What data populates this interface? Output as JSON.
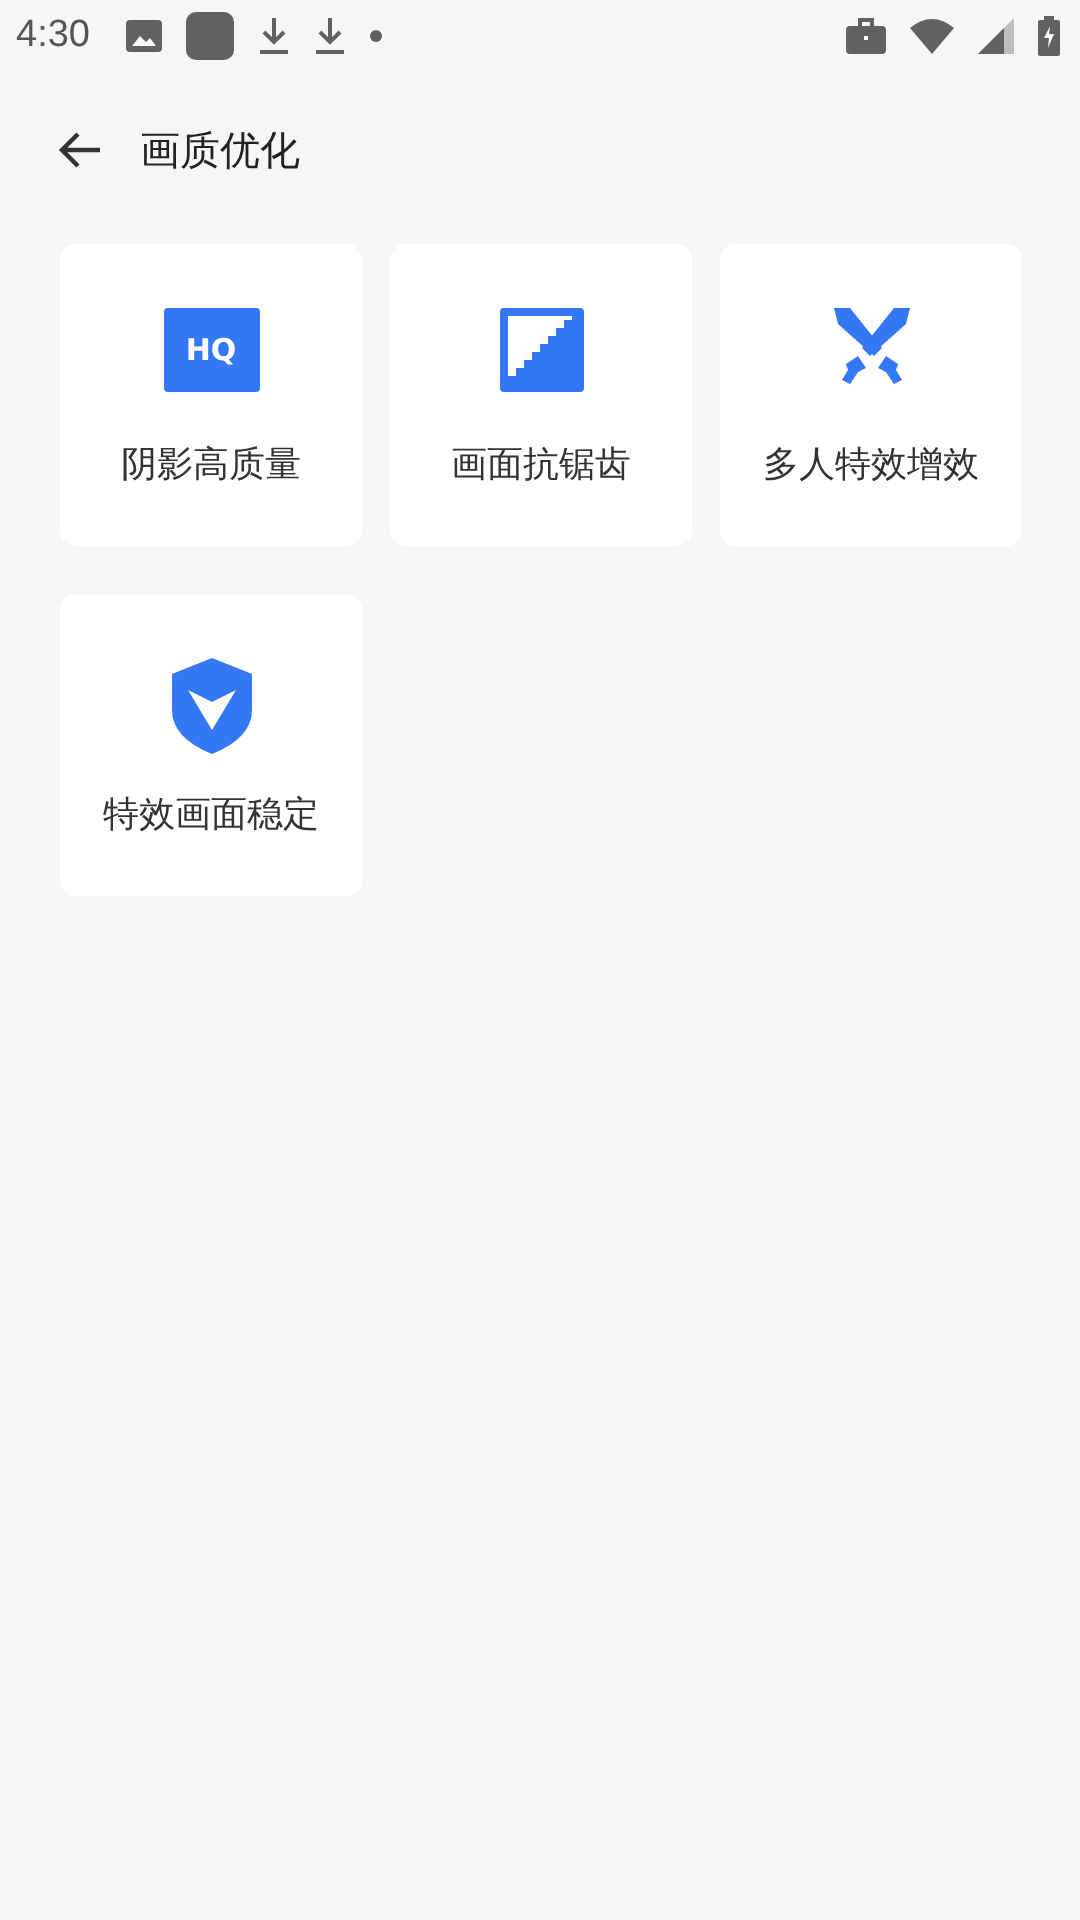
{
  "status_bar": {
    "time": "4:30"
  },
  "header": {
    "title": "画质优化"
  },
  "options": [
    {
      "kind": "hq",
      "badge": "HQ",
      "label": "阴影高质量"
    },
    {
      "kind": "staircase",
      "label": "画面抗锯齿"
    },
    {
      "kind": "swords",
      "label": "多人特效增效"
    },
    {
      "kind": "shield",
      "label": "特效画面稳定"
    }
  ]
}
